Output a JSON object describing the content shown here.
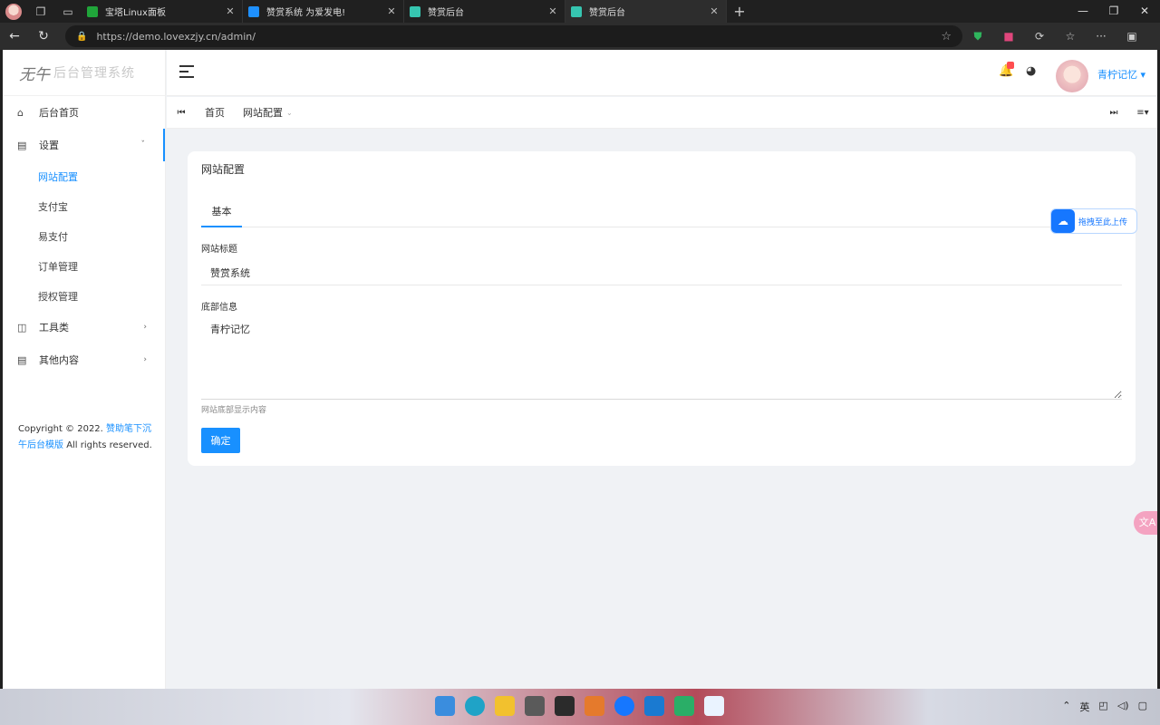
{
  "browser": {
    "tabs": [
      {
        "title": "宝塔Linux面板",
        "favicon_color": "#20a53a",
        "active": false
      },
      {
        "title": "赞赏系统 为爱发电!",
        "favicon_color": "#1e90ff",
        "active": false
      },
      {
        "title": "赞赏后台",
        "favicon_color": "#36c5b0",
        "active": false
      },
      {
        "title": "赞赏后台",
        "favicon_color": "#36c5b0",
        "active": true
      }
    ],
    "url": "https://demo.lovexzjy.cn/admin/"
  },
  "app": {
    "logo_mark": "无午",
    "logo_text": "后台管理系统"
  },
  "sidebar": {
    "items": [
      {
        "label": "后台首页",
        "icon": "dashboard-icon",
        "has_arrow": false
      },
      {
        "label": "设置",
        "icon": "settings-icon",
        "has_arrow": true,
        "open": true
      },
      {
        "label": "工具类",
        "icon": "tools-icon",
        "has_arrow": true
      },
      {
        "label": "其他内容",
        "icon": "content-icon",
        "has_arrow": true
      }
    ],
    "sub_items": [
      {
        "label": "网站配置",
        "active": true
      },
      {
        "label": "支付宝"
      },
      {
        "label": "易支付"
      },
      {
        "label": "订单管理"
      },
      {
        "label": "授权管理"
      }
    ],
    "copyright": {
      "prefix": "Copyright © 2022.",
      "link": "赞助笔下沉午后台模版",
      "suffix": "All rights reserved."
    }
  },
  "topbar": {
    "username": "青柠记忆",
    "notification_count": ""
  },
  "tagsbar": {
    "tags": [
      "首页",
      "网站配置"
    ]
  },
  "card": {
    "title": "网站配置",
    "tab": "基本",
    "fields": {
      "site_title_label": "网站标题",
      "site_title_value": "赞赏系统",
      "footer_label": "底部信息",
      "footer_value": "青柠记忆",
      "footer_hint": "网站底部显示内容"
    },
    "submit_label": "确定"
  },
  "floats": {
    "upload_label": "拖拽至此上传",
    "translate_label": "文A"
  },
  "colors": {
    "accent": "#1890ff",
    "background": "#f0f2f5"
  }
}
